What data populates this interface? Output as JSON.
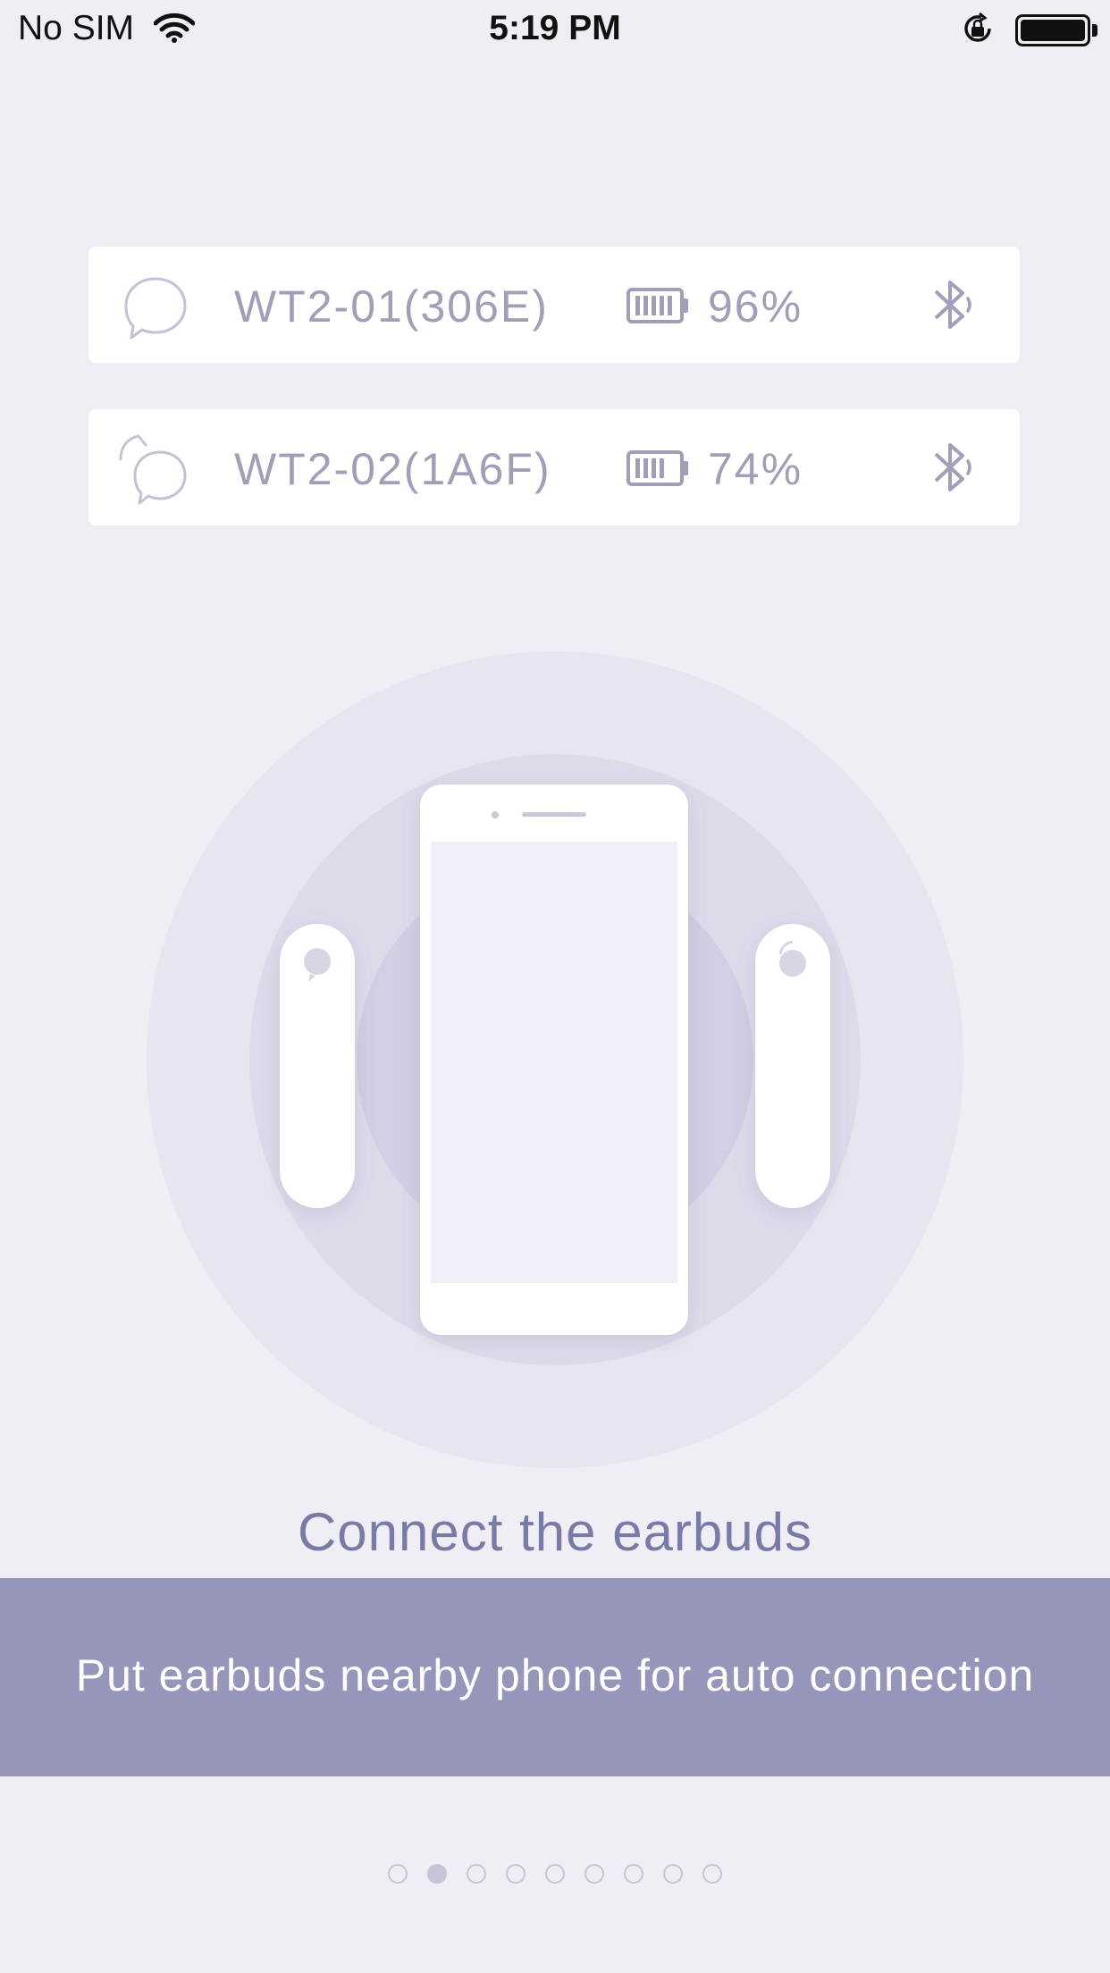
{
  "status_bar": {
    "carrier": "No SIM",
    "time": "5:19 PM",
    "icons": [
      "wifi-icon",
      "rotation-lock-icon",
      "battery-icon"
    ]
  },
  "devices": [
    {
      "name": "WT2-01(306E)",
      "battery": "96%",
      "battery_level": 0.96,
      "icon": "earbud-bubble-icon",
      "status_icon": "bluetooth-connected-icon"
    },
    {
      "name": "WT2-02(1A6F)",
      "battery": "74%",
      "battery_level": 0.74,
      "icon": "earbud-bubble-pressed-icon",
      "status_icon": "bluetooth-connected-icon"
    }
  ],
  "main": {
    "title": "Connect the earbuds",
    "hint": "Put earbuds nearby phone for auto connection"
  },
  "pager": {
    "total": 9,
    "current": 2
  },
  "colors": {
    "background": "#efeef5",
    "accent": "#9696bb",
    "title": "#7a7aa6",
    "muted_text": "#a19fb8"
  }
}
